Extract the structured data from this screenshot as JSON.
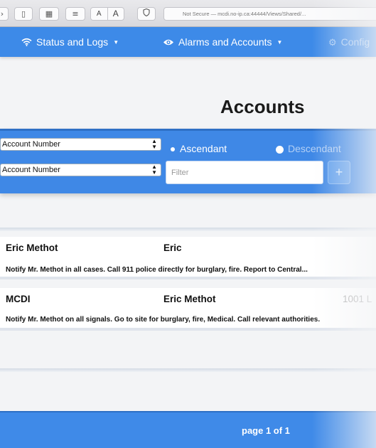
{
  "browser": {
    "url_text": "Not Secure — mcdi.no-ip.ca:44444/Views/Shared/...",
    "font_small": "A",
    "font_large": "A"
  },
  "nav": {
    "status_logs": "Status and Logs",
    "alarms_accounts": "Alarms and Accounts",
    "config": "Config"
  },
  "page": {
    "title": "Accounts"
  },
  "sort": {
    "primary_select": "Account Number",
    "secondary_select": "Account Number",
    "ascendant_label": "Ascendant",
    "descendant_label": "Descendant",
    "filter_placeholder": "Filter",
    "add_label": "+"
  },
  "accounts": [
    {
      "number": "Eric Methot",
      "name": "Eric",
      "extra": "",
      "note": "Notify Mr. Methot in all cases. Call 911 police directly for burglary, fire. Report to Central..."
    },
    {
      "number": "MCDI",
      "name": "Eric Methot",
      "extra": "1001 L",
      "note": "Notify Mr. Methot on all signals. Go to site for burglary, fire, Medical. Call relevant authorities."
    }
  ],
  "pagination": {
    "label": "page 1 of 1"
  },
  "colors": {
    "brand_blue": "#3d8ae8",
    "dark_blue": "#2f70c6"
  },
  "icons": {
    "wifi": "wifi-icon",
    "eye": "eye-icon",
    "gear": "gear-icon",
    "shield": "shield-icon",
    "sidebar": "sidebar-icon",
    "grid": "grid-icon",
    "reader": "reader-icon"
  }
}
